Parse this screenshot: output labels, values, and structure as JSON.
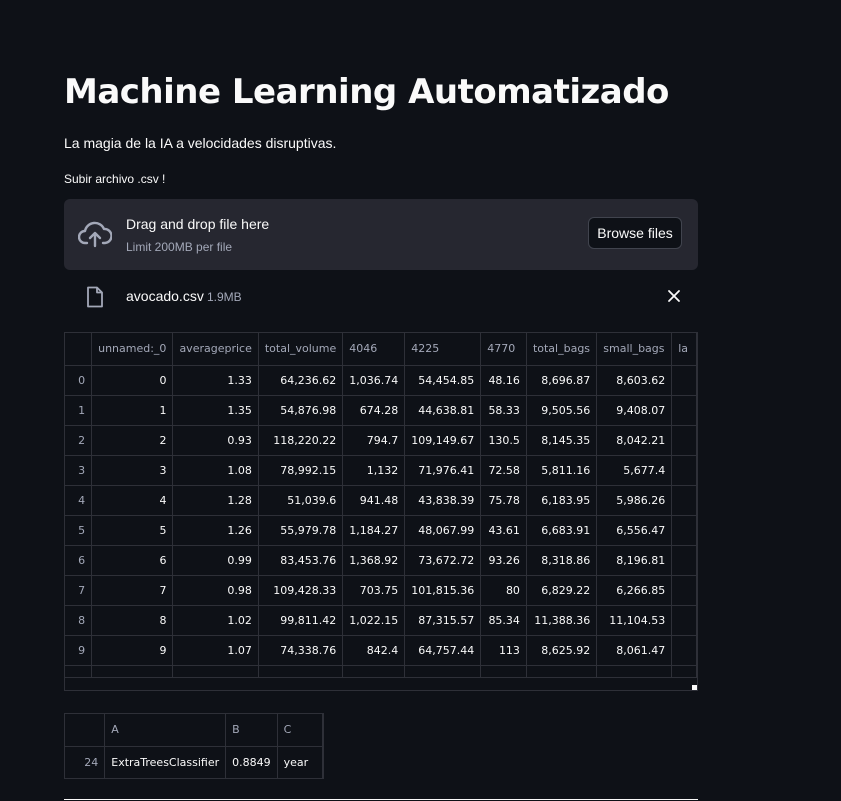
{
  "title": "Machine Learning Automatizado",
  "subtitle": "La magia de la IA a velocidades disruptivas.",
  "uploader": {
    "label": "Subir archivo .csv !",
    "instruction": "Drag and drop file here",
    "limit": "Limit 200MB per file",
    "browse_label": "Browse files",
    "icon": "cloud-upload-icon"
  },
  "file": {
    "name": "avocado.csv",
    "size": "1.9MB",
    "icon": "file-icon",
    "close_icon": "close-icon"
  },
  "dataframe": {
    "columns": [
      "unnamed:_0",
      "averageprice",
      "total_volume",
      "4046",
      "4225",
      "4770",
      "total_bags",
      "small_bags",
      "la"
    ],
    "rows": [
      {
        "index": "0",
        "cells": [
          "0",
          "1.33",
          "64,236.62",
          "1,036.74",
          "54,454.85",
          "48.16",
          "8,696.87",
          "8,603.62",
          ""
        ]
      },
      {
        "index": "1",
        "cells": [
          "1",
          "1.35",
          "54,876.98",
          "674.28",
          "44,638.81",
          "58.33",
          "9,505.56",
          "9,408.07",
          ""
        ]
      },
      {
        "index": "2",
        "cells": [
          "2",
          "0.93",
          "118,220.22",
          "794.7",
          "109,149.67",
          "130.5",
          "8,145.35",
          "8,042.21",
          ""
        ]
      },
      {
        "index": "3",
        "cells": [
          "3",
          "1.08",
          "78,992.15",
          "1,132",
          "71,976.41",
          "72.58",
          "5,811.16",
          "5,677.4",
          ""
        ]
      },
      {
        "index": "4",
        "cells": [
          "4",
          "1.28",
          "51,039.6",
          "941.48",
          "43,838.39",
          "75.78",
          "6,183.95",
          "5,986.26",
          ""
        ]
      },
      {
        "index": "5",
        "cells": [
          "5",
          "1.26",
          "55,979.78",
          "1,184.27",
          "48,067.99",
          "43.61",
          "6,683.91",
          "6,556.47",
          ""
        ]
      },
      {
        "index": "6",
        "cells": [
          "6",
          "0.99",
          "83,453.76",
          "1,368.92",
          "73,672.72",
          "93.26",
          "8,318.86",
          "8,196.81",
          ""
        ]
      },
      {
        "index": "7",
        "cells": [
          "7",
          "0.98",
          "109,428.33",
          "703.75",
          "101,815.36",
          "80",
          "6,829.22",
          "6,266.85",
          ""
        ]
      },
      {
        "index": "8",
        "cells": [
          "8",
          "1.02",
          "99,811.42",
          "1,022.15",
          "87,315.57",
          "85.34",
          "11,388.36",
          "11,104.53",
          ""
        ]
      },
      {
        "index": "9",
        "cells": [
          "9",
          "1.07",
          "74,338.76",
          "842.4",
          "64,757.44",
          "113",
          "8,625.92",
          "8,061.47",
          ""
        ]
      },
      {
        "index": "",
        "cells": [
          "",
          "",
          "",
          "",
          "",
          "",
          "",
          "",
          ""
        ]
      }
    ]
  },
  "result_table": {
    "columns": [
      "A",
      "B",
      "C"
    ],
    "rows": [
      {
        "index": "24",
        "cells": [
          "ExtraTreesClassifier",
          "0.8849",
          "year"
        ]
      }
    ]
  },
  "colors": {
    "background": "#0e1117",
    "panel": "#262730",
    "border": "#2e3038",
    "text": "#fafafa",
    "muted": "#a3a8b8"
  }
}
